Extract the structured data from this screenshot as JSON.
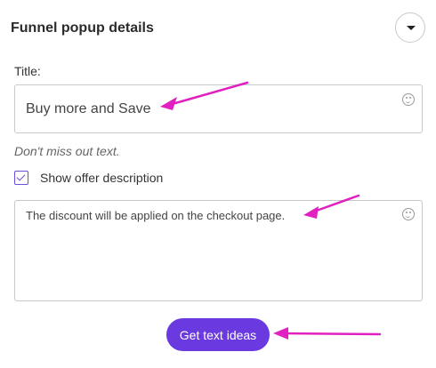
{
  "header": {
    "title": "Funnel popup details",
    "collapse_icon": "chevron-down-icon"
  },
  "title_field": {
    "label": "Title:",
    "value": "Buy more and Save",
    "emoji_icon": "smiley-icon"
  },
  "hint": "Don't miss out text.",
  "offer_description": {
    "checkbox_label": "Show offer description",
    "checked": true,
    "value": "The discount will be applied on the checkout page.",
    "emoji_icon": "smiley-icon"
  },
  "cta": {
    "label": "Get text ideas"
  },
  "colors": {
    "accent": "#6a3ae0",
    "annotation_arrow": "#e020c0",
    "border": "#c9c9c9"
  }
}
